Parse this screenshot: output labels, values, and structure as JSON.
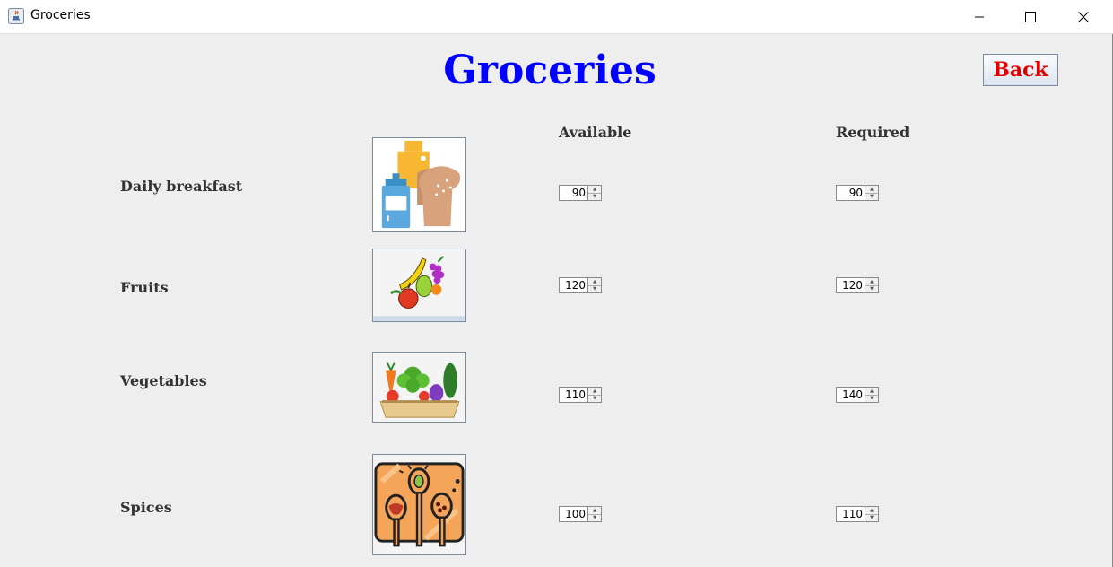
{
  "window": {
    "title": "Groceries",
    "controls": {
      "minimize_icon": "minimize-icon",
      "maximize_icon": "maximize-icon",
      "close_icon": "close-icon"
    }
  },
  "main": {
    "heading": "Groceries",
    "back_label": "Back",
    "columns": {
      "available": "Available",
      "required": "Required"
    },
    "rows": [
      {
        "label": "Daily breakfast",
        "image": "breakfast-image",
        "available": "90",
        "required": "90"
      },
      {
        "label": "Fruits",
        "image": "fruits-image",
        "available": "120",
        "required": "120"
      },
      {
        "label": "Vegetables",
        "image": "vegetables-image",
        "available": "110",
        "required": "140"
      },
      {
        "label": "Spices",
        "image": "spices-image",
        "available": "100",
        "required": "110"
      }
    ]
  },
  "colors": {
    "heading": "#0000ff",
    "back": "#e00000",
    "background": "#eeeeee"
  }
}
